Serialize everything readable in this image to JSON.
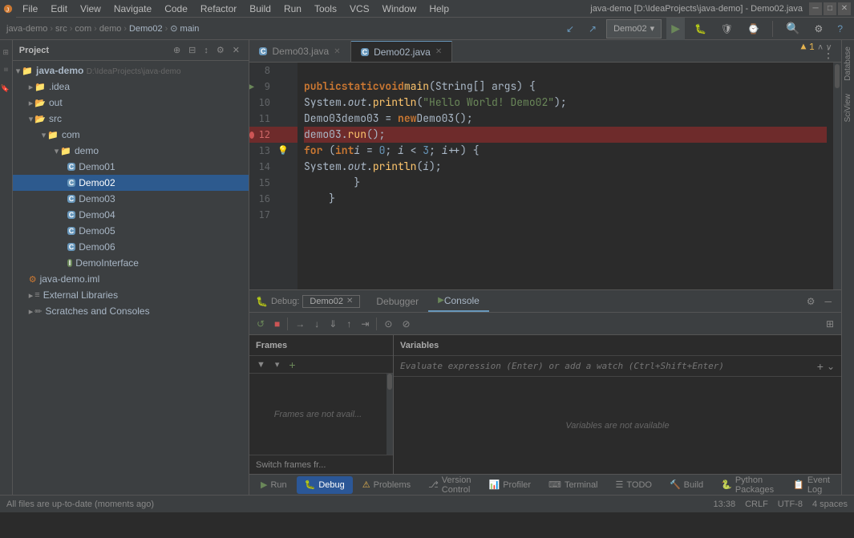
{
  "app": {
    "title": "java-demo [D:\\IdeaProjects\\java-demo] - Demo02.java",
    "logo": "✦"
  },
  "menubar": {
    "items": [
      "File",
      "Edit",
      "View",
      "Navigate",
      "Code",
      "Refactor",
      "Build",
      "Run",
      "Tools",
      "VCS",
      "Window",
      "Help"
    ]
  },
  "breadcrumb": {
    "items": [
      "java-demo",
      "src",
      "com",
      "demo",
      "Demo02",
      "main"
    ]
  },
  "toolbar": {
    "run_config": "Demo02",
    "run_label": "▶",
    "debug_label": "🐛"
  },
  "project": {
    "title": "Project",
    "root": {
      "name": "java-demo",
      "path": "D:\\IdeaProjects\\java-demo",
      "children": [
        {
          "name": ".idea",
          "type": "folder",
          "indent": 1
        },
        {
          "name": "out",
          "type": "folder_open",
          "indent": 1
        },
        {
          "name": "src",
          "type": "folder_open",
          "indent": 1
        },
        {
          "name": "com",
          "type": "folder_open",
          "indent": 2
        },
        {
          "name": "demo",
          "type": "folder_open",
          "indent": 3
        },
        {
          "name": "Demo01",
          "type": "java",
          "indent": 4
        },
        {
          "name": "Demo02",
          "type": "java",
          "indent": 4,
          "selected": true
        },
        {
          "name": "Demo03",
          "type": "java",
          "indent": 4
        },
        {
          "name": "Demo04",
          "type": "java",
          "indent": 4
        },
        {
          "name": "Demo05",
          "type": "java",
          "indent": 4
        },
        {
          "name": "Demo06",
          "type": "java",
          "indent": 4
        },
        {
          "name": "DemoInterface",
          "type": "java_interface",
          "indent": 4
        },
        {
          "name": "java-demo.iml",
          "type": "iml",
          "indent": 1
        },
        {
          "name": "External Libraries",
          "type": "folder",
          "indent": 1
        },
        {
          "name": "Scratches and Consoles",
          "type": "folder",
          "indent": 1
        }
      ]
    }
  },
  "editor": {
    "tabs": [
      {
        "name": "Demo03.java",
        "active": false,
        "modified": false
      },
      {
        "name": "Demo02.java",
        "active": true,
        "modified": false
      }
    ],
    "lines": [
      {
        "num": 8,
        "content": "",
        "has_run": false,
        "has_breakpoint": false
      },
      {
        "num": 9,
        "content": "    public static void main(String[] args) {",
        "has_run": true,
        "has_breakpoint": false
      },
      {
        "num": 10,
        "content": "        System.out.println(\"Hello World! Demo02\");",
        "has_run": false,
        "has_breakpoint": false
      },
      {
        "num": 11,
        "content": "        Demo03 demo03 = new Demo03();",
        "has_run": false,
        "has_breakpoint": false
      },
      {
        "num": 12,
        "content": "        demo03.run();",
        "has_run": false,
        "has_breakpoint": true
      },
      {
        "num": 13,
        "content": "        for (int i = 0; i < 3; i++) {",
        "has_run": false,
        "has_breakpoint": false,
        "has_warning": true
      },
      {
        "num": 14,
        "content": "            System.out.println(i);",
        "has_run": false,
        "has_breakpoint": false
      },
      {
        "num": 15,
        "content": "        }",
        "has_run": false,
        "has_breakpoint": false
      },
      {
        "num": 16,
        "content": "    }",
        "has_run": false,
        "has_breakpoint": false
      },
      {
        "num": 17,
        "content": "",
        "has_run": false,
        "has_breakpoint": false
      }
    ],
    "warning_badge": "▲ 1"
  },
  "debug": {
    "title": "Debug:",
    "config": "Demo02",
    "tabs": [
      "Debugger",
      "Console"
    ],
    "active_tab": "Console",
    "frames_header": "Frames",
    "variables_header": "Variables",
    "frames_empty": "Frames are not avail...",
    "variables_empty": "Variables are not available",
    "variables_placeholder": "Evaluate expression (Enter) or add a watch (Ctrl+Shift+Enter)",
    "switch_frames_label": "Switch frames fr..."
  },
  "bottom_tabs": [
    {
      "name": "Run",
      "icon": "▶",
      "active": false
    },
    {
      "name": "Debug",
      "icon": "🐛",
      "active": true
    },
    {
      "name": "Problems",
      "icon": "⚠",
      "active": false
    },
    {
      "name": "Version Control",
      "icon": "⎇",
      "active": false
    },
    {
      "name": "Profiler",
      "icon": "📊",
      "active": false
    },
    {
      "name": "Terminal",
      "icon": "⌨",
      "active": false
    },
    {
      "name": "TODO",
      "icon": "☰",
      "active": false
    },
    {
      "name": "Build",
      "icon": "🔨",
      "active": false
    },
    {
      "name": "Python Packages",
      "icon": "🐍",
      "active": false
    },
    {
      "name": "Event Log",
      "icon": "📋",
      "active": false
    }
  ],
  "statusbar": {
    "message": "All files are up-to-date (moments ago)",
    "time": "13:38",
    "line_ending": "CRLF",
    "encoding": "UTF-8",
    "indent": "4 spaces"
  }
}
